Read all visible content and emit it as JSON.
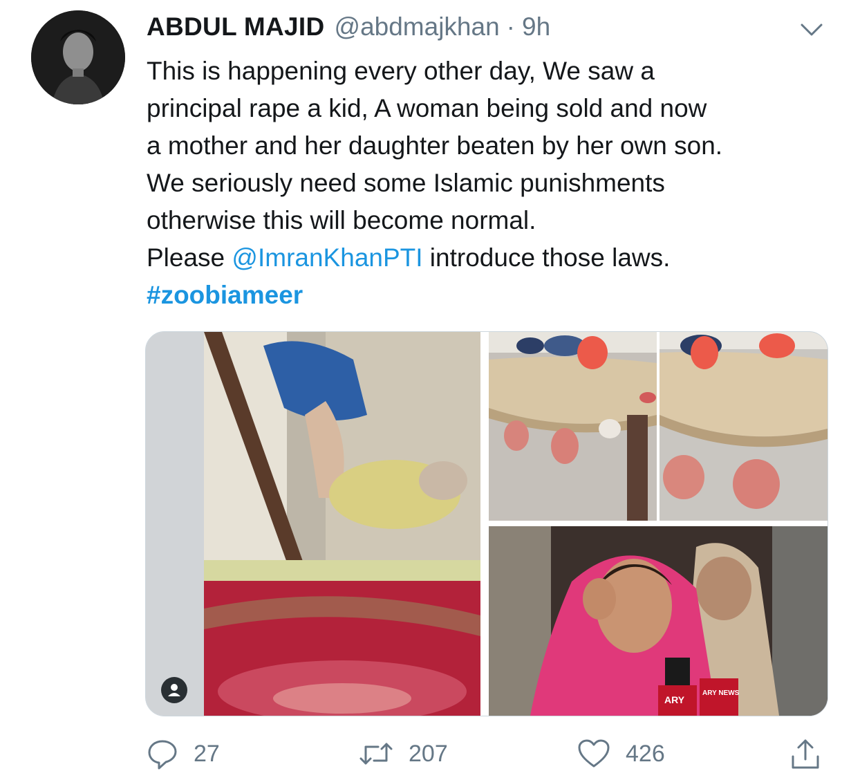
{
  "tweet": {
    "author_name": "ABDUL MAJID",
    "author_handle": "@abdmajkhan",
    "separator": "·",
    "time": "9h",
    "text_lines": [
      "This is happening every other day, We saw a",
      "principal rape a kid, A woman being sold and now",
      "a mother and her daughter beaten by her own son.",
      "We seriously need some Islamic punishments",
      "otherwise this will become normal."
    ],
    "please_prefix": "Please ",
    "mention": "@ImranKhanPTI",
    "please_suffix": " introduce those laws.",
    "hashtag": "#zoobiameer"
  },
  "media": {
    "tiles": [
      "video-frame-scuffle",
      "photo-mattress-slippers",
      "photo-mattress-slippers-closeup",
      "photo-crying-woman-ary-news"
    ],
    "mic_logo_text": "ARY",
    "mic_logo_text_2": "ARY NEWS"
  },
  "actions": {
    "reply_count": "27",
    "retweet_count": "207",
    "like_count": "426"
  },
  "icons": {
    "caret": "chevron-down-icon",
    "reply": "reply-icon",
    "retweet": "retweet-icon",
    "like": "heart-icon",
    "share": "share-icon",
    "person": "person-icon"
  },
  "colors": {
    "link": "#1b95e0",
    "secondary_text": "#657786",
    "primary_text": "#14171a"
  }
}
